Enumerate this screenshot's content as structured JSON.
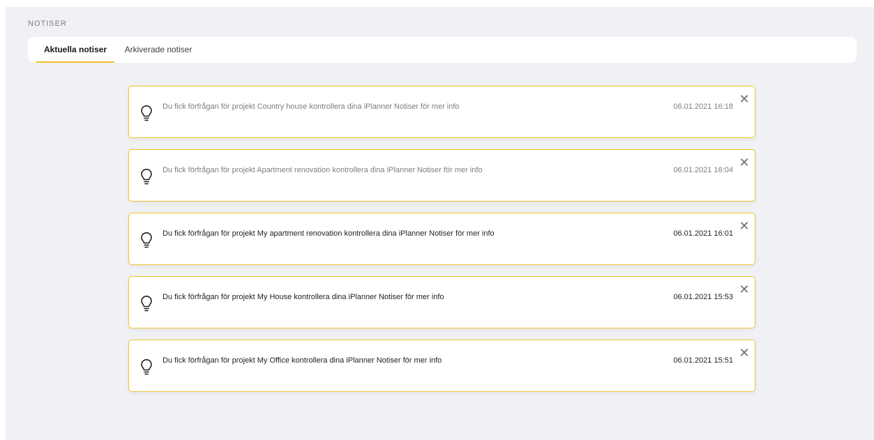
{
  "section": {
    "title": "NOTISER"
  },
  "tabs": [
    {
      "label": "Aktuella notiser",
      "active": true
    },
    {
      "label": "Arkiverade notiser",
      "active": false
    }
  ],
  "notifications": [
    {
      "message": "Du fick förfrågan för projekt Country house kontrollera dina iPlanner Notiser för mer info",
      "timestamp": "06.01.2021 16:18",
      "read": true
    },
    {
      "message": "Du fick förfrågan för projekt Apartment renovation kontrollera dina iPlanner Notiser för mer info",
      "timestamp": "06.01.2021 16:04",
      "read": true
    },
    {
      "message": "Du fick förfrågan för projekt My apartment renovation kontrollera dina iPlanner Notiser för mer info",
      "timestamp": "06.01.2021 16:01",
      "read": false
    },
    {
      "message": "Du fick förfrågan för projekt My House kontrollera dina iPlanner Notiser för mer info",
      "timestamp": "06.01.2021 15:53",
      "read": false
    },
    {
      "message": "Du fick förfrågan för projekt My Office kontrollera dina iPlanner Notiser för mer info",
      "timestamp": "06.01.2021 15:51",
      "read": false
    }
  ],
  "icons": {
    "notification": "lightbulb-icon",
    "dismiss": "close-icon"
  },
  "colors": {
    "accent": "#f0c228",
    "card_border": "#f0c530",
    "read_text": "#7b7e85",
    "unread_text": "#1d1f23"
  }
}
